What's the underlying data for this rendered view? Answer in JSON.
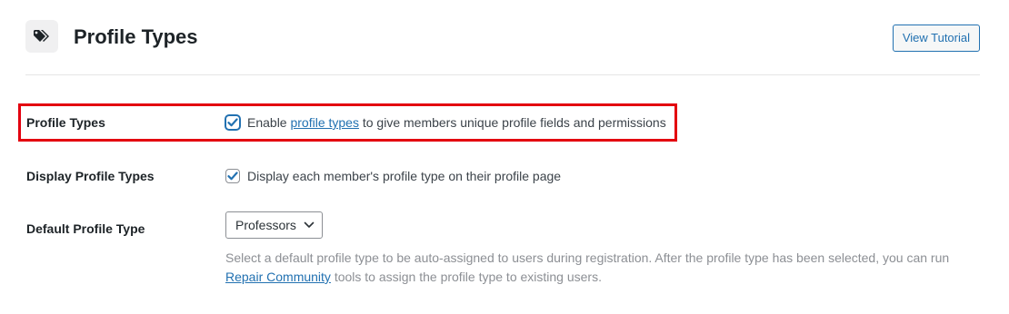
{
  "header": {
    "icon": "tags-icon",
    "title": "Profile Types",
    "tutorial_button": "View Tutorial"
  },
  "settings": {
    "profile_types": {
      "label": "Profile Types",
      "checked": true,
      "text_before": "Enable ",
      "link_text": "profile types",
      "text_after": " to give members unique profile fields and permissions"
    },
    "display_profile_types": {
      "label": "Display Profile Types",
      "checked": true,
      "text": "Display each member's profile type on their profile page"
    },
    "default_profile_type": {
      "label": "Default Profile Type",
      "selected": "Professors",
      "description_before": "Select a default profile type to be auto-assigned to users during registration. After the profile type has been selected, you can run ",
      "description_link": "Repair Community",
      "description_after": " tools to assign the profile type to existing users."
    }
  },
  "colors": {
    "accent": "#2271b1",
    "highlight": "#e3000f"
  }
}
